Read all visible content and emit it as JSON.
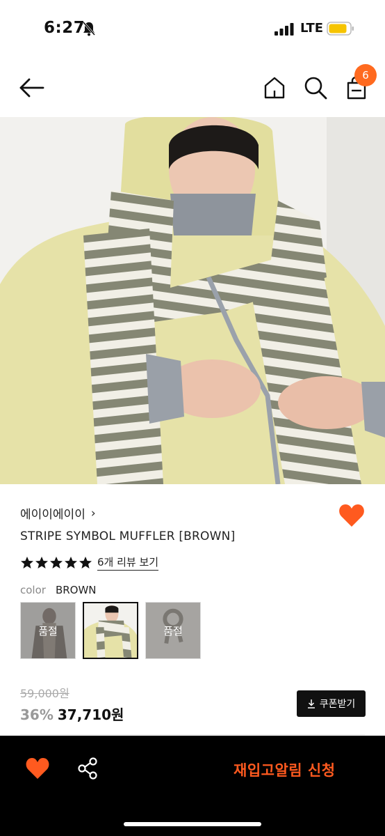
{
  "status": {
    "time": "6:27",
    "network": "LTE",
    "battery_color": "#f6c400"
  },
  "nav": {
    "cart_count": "6",
    "accent": "#ff6a1f"
  },
  "product": {
    "brand": "에이이에이이",
    "brand_chevron": "›",
    "title": "STRIPE SYMBOL MUFFLER [BROWN]",
    "rating_stars": 5,
    "review_link": "6개 리뷰 보기",
    "option_label": "color",
    "option_value": "BROWN",
    "swatches": [
      {
        "soldout_label": "품절"
      },
      {
        "soldout_label": ""
      },
      {
        "soldout_label": "품절"
      }
    ],
    "original_price": "59,000원",
    "discount": "36%",
    "price": "37,710원",
    "coupon_label": "쿠폰받기"
  },
  "bottom_bar": {
    "restock_label": "재입고알림 신청"
  },
  "icons": [
    "bell-off-icon",
    "signal-icon",
    "battery-icon",
    "back-arrow-icon",
    "home-icon",
    "search-icon",
    "bag-icon",
    "heart-icon",
    "star-icon",
    "download-icon",
    "share-icon"
  ]
}
